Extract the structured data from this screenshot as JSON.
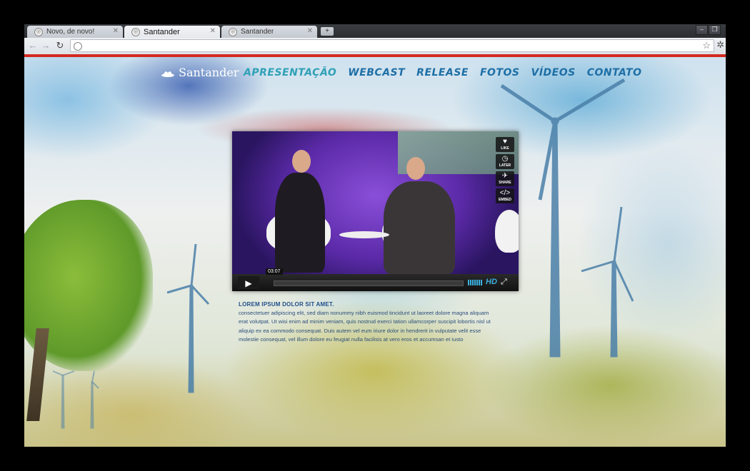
{
  "browser": {
    "tabs": [
      {
        "title": "Novo, de novo!",
        "state": "inactive"
      },
      {
        "title": "Santander",
        "state": "active"
      },
      {
        "title": "Santander",
        "state": "inactive"
      }
    ],
    "new_tab": "+",
    "address": "",
    "window_controls": [
      "–",
      "❐"
    ]
  },
  "site": {
    "logo_text": "Santander",
    "nav": [
      "APRESENTAÇÃO",
      "WEBCAST",
      "RELEASE",
      "FOTOS",
      "VÍDEOS",
      "CONTATO"
    ]
  },
  "video": {
    "time": "03:07",
    "side_buttons": [
      {
        "icon": "heart-icon",
        "glyph": "♥",
        "label": "LIKE"
      },
      {
        "icon": "clock-icon",
        "glyph": "◷",
        "label": "LATER"
      },
      {
        "icon": "share-icon",
        "glyph": "✈",
        "label": "SHARE"
      },
      {
        "icon": "embed-icon",
        "glyph": "</>",
        "label": "EMBED"
      }
    ],
    "play_glyph": "▶",
    "hd_label": "HD",
    "fullscreen_glyph": "⤢",
    "progress": 0.0
  },
  "article": {
    "title": "LOREM IPSUM DOLOR SIT AMET.",
    "body": "consectetuer adipiscing elit, sed diam nonummy nibh euismod tincidunt ut laoreet dolore magna aliquam erat volutpat. Ut wisi enim ad minim veniam, quis nostrud exerci tation ullamcorper suscipit lobortis nisl ut aliquip ex ea commodo consequat. Duis autem vel eum iriure dolor in hendrerit in vulputate velit esse molestie consequat, vel illum dolore eu feugiat nulla facilisis at vero eros et accumsan et iusto"
  }
}
